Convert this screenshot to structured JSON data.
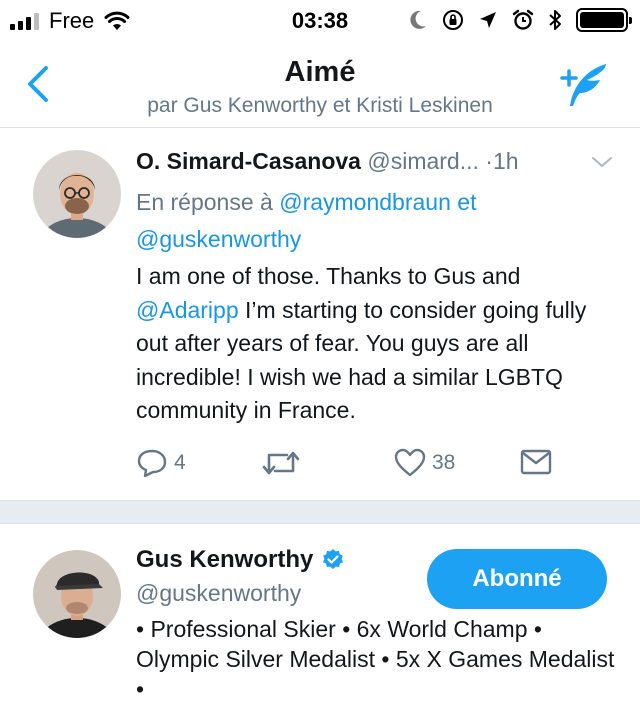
{
  "status_bar": {
    "carrier": "Free",
    "time": "03:38"
  },
  "nav": {
    "title": "Aimé",
    "subtitle": "par Gus Kenworthy et Kristi Leskinen"
  },
  "tweet": {
    "author_name": "O. Simard-Casanova",
    "author_handle": "@simard...",
    "separator": "·",
    "time": "1h",
    "reply_prefix": "En réponse à",
    "reply_mention_1": "@raymondbraun",
    "reply_joiner": "et",
    "reply_mention_2": "@guskenworthy",
    "text_part_1": "I am one of those. Thanks to Gus and",
    "text_mention": "@Adaripp",
    "text_part_2": "I’m starting to consider going fully out after years of fear. You guys are all incredible! I wish we had a similar LGBTQ community in France.",
    "reply_count": "4",
    "retweet_count": "",
    "like_count": "38"
  },
  "user": {
    "name": "Gus Kenworthy",
    "handle": "@guskenworthy",
    "follow_label": "Abonné",
    "bio": "• Professional Skier • 6x World Champ • Olympic Silver Medalist • 5x X Games Medalist •"
  },
  "colors": {
    "accent": "#1da1f2",
    "link": "#1b95e0",
    "secondary_text": "#657786",
    "separator": "#e6ecf0"
  }
}
